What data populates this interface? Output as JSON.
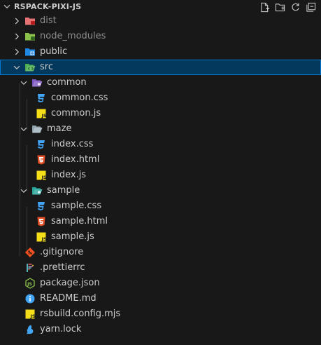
{
  "explorer": {
    "title": "RSPACK-PIXI-JS",
    "actions": [
      "new-file-icon",
      "new-folder-icon",
      "refresh-icon",
      "collapse-all-icon"
    ]
  },
  "tree": {
    "dist": "dist",
    "node_modules": "node_modules",
    "public": "public",
    "src": "src",
    "common": "common",
    "common_css": "common.css",
    "common_js": "common.js",
    "maze": "maze",
    "index_css": "index.css",
    "index_html": "index.html",
    "index_js": "index.js",
    "sample": "sample",
    "sample_css": "sample.css",
    "sample_html": "sample.html",
    "sample_js": "sample.js",
    "gitignore": ".gitignore",
    "prettierrc": ".prettierrc",
    "package_json": "package.json",
    "readme": "README.md",
    "rsbuild": "rsbuild.config.mjs",
    "yarn_lock": "yarn.lock"
  },
  "colors": {
    "background": "#181818",
    "selection": "#04395e",
    "selection_border": "#0078d4",
    "css": "#42a5f5",
    "html": "#e44d26",
    "js": "#f5de19"
  }
}
